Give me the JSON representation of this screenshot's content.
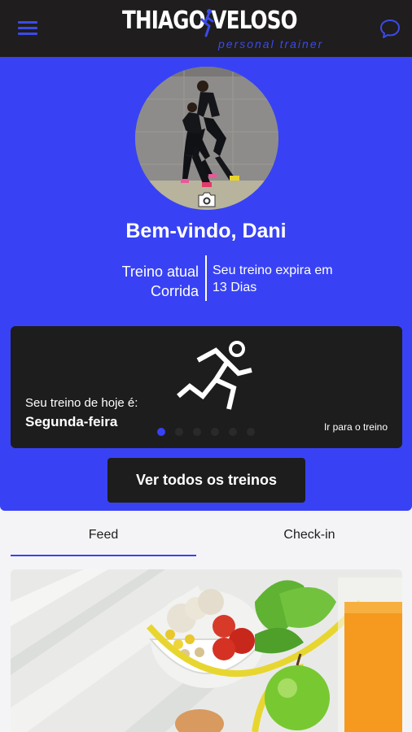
{
  "brand": {
    "name": "THIAGO VELOSO",
    "tagline": "personal trainer",
    "accent": "#3842f4",
    "dark": "#1d1d1e"
  },
  "header": {
    "menu_icon": "hamburger-menu-icon",
    "chat_icon": "chat-bubble-icon"
  },
  "profile": {
    "welcome": "Bem-vindo, Dani",
    "current_label": "Treino atual",
    "current_value": "Corrida",
    "expires_label": "Seu treino expira em",
    "expires_value": "13 Dias",
    "camera_icon": "camera-icon"
  },
  "workout_card": {
    "today_label": "Seu treino de hoje é:",
    "today_day": "Segunda-feira",
    "go_link": "Ir para o treino",
    "icon": "runner-icon",
    "slides": 6,
    "active_slide": 0
  },
  "actions": {
    "all_workouts": "Ver todos os treinos"
  },
  "tabs": [
    {
      "label": "Feed",
      "active": true
    },
    {
      "label": "Check-in",
      "active": false
    }
  ]
}
